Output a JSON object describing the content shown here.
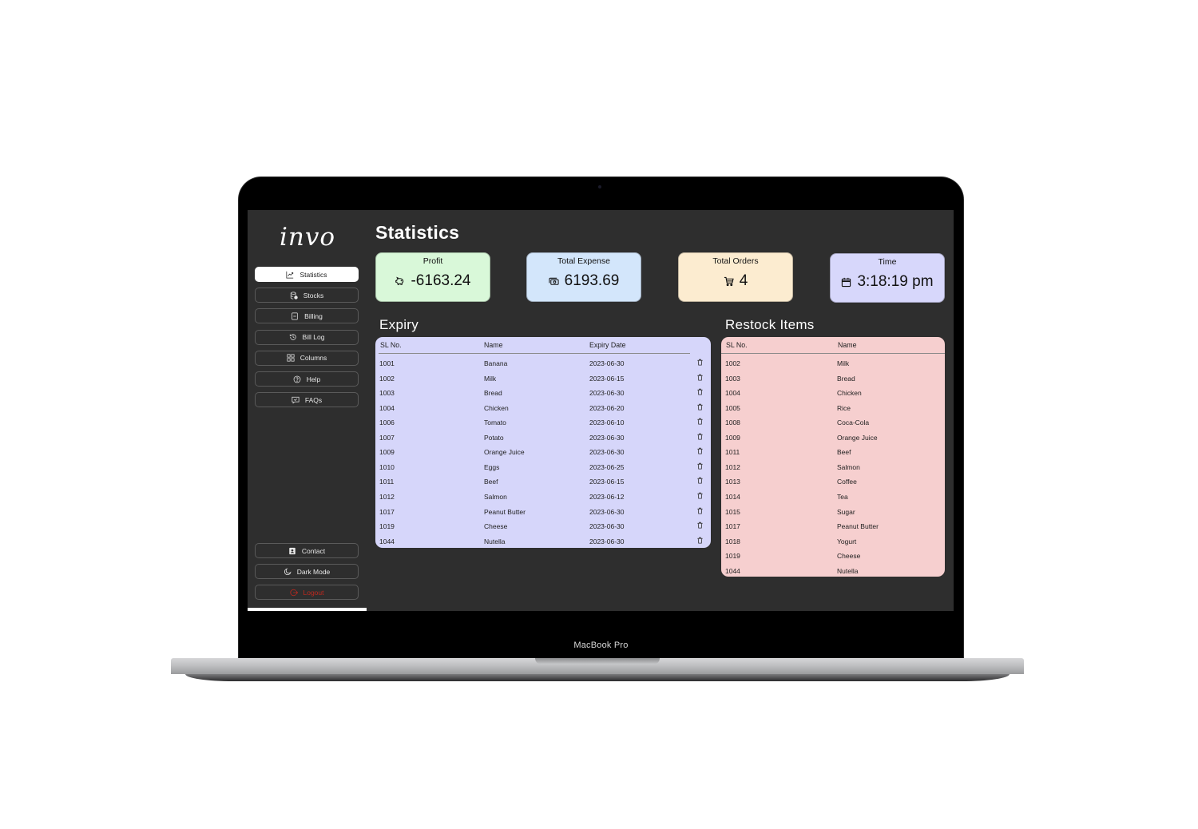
{
  "device": {
    "label": "MacBook Pro"
  },
  "app": {
    "logo": "INVO",
    "sidebar": {
      "items": [
        {
          "label": "Statistics",
          "icon": "chart-line-icon",
          "active": true
        },
        {
          "label": "Stocks",
          "icon": "database-check-icon",
          "active": false
        },
        {
          "label": "Billing",
          "icon": "receipt-icon",
          "active": false
        },
        {
          "label": "Bill Log",
          "icon": "history-icon",
          "active": false
        },
        {
          "label": "Columns",
          "icon": "grid-columns-icon",
          "active": false
        },
        {
          "label": "Help",
          "icon": "question-circle-icon",
          "active": false
        },
        {
          "label": "FAQs",
          "icon": "chat-check-icon",
          "active": false
        }
      ],
      "bottom_items": [
        {
          "label": "Contact",
          "icon": "contact-card-icon"
        },
        {
          "label": "Dark Mode",
          "icon": "moon-icon"
        },
        {
          "label": "Logout",
          "icon": "logout-icon"
        }
      ]
    },
    "page_title": "Statistics",
    "stats": [
      {
        "label": "Profit",
        "value": "-6163.24",
        "icon": "piggy-bank-icon",
        "color": "#d9f8d9"
      },
      {
        "label": "Total Expense",
        "value": "6193.69",
        "icon": "cash-icon",
        "color": "#d3e6fb"
      },
      {
        "label": "Total Orders",
        "value": "4",
        "icon": "cart-icon",
        "color": "#fcecd0"
      },
      {
        "label": "Time",
        "value": "3:18:19 pm",
        "icon": "calendar-icon",
        "color": "#d7d7fb"
      }
    ],
    "expiry": {
      "title": "Expiry",
      "columns": [
        "SL No.",
        "Name",
        "Expiry Date"
      ],
      "color": "#d6d6fa",
      "rows": [
        {
          "sl": "1001",
          "name": "Banana",
          "date": "2023-06-30"
        },
        {
          "sl": "1002",
          "name": "Milk",
          "date": "2023-06-15"
        },
        {
          "sl": "1003",
          "name": "Bread",
          "date": "2023-06-30"
        },
        {
          "sl": "1004",
          "name": "Chicken",
          "date": "2023-06-20"
        },
        {
          "sl": "1006",
          "name": "Tomato",
          "date": "2023-06-10"
        },
        {
          "sl": "1007",
          "name": "Potato",
          "date": "2023-06-30"
        },
        {
          "sl": "1009",
          "name": "Orange Juice",
          "date": "2023-06-30"
        },
        {
          "sl": "1010",
          "name": "Eggs",
          "date": "2023-06-25"
        },
        {
          "sl": "1011",
          "name": "Beef",
          "date": "2023-06-15"
        },
        {
          "sl": "1012",
          "name": "Salmon",
          "date": "2023-06-12"
        },
        {
          "sl": "1017",
          "name": "Peanut Butter",
          "date": "2023-06-30"
        },
        {
          "sl": "1019",
          "name": "Cheese",
          "date": "2023-06-30"
        },
        {
          "sl": "1044",
          "name": "Nutella",
          "date": "2023-06-30"
        }
      ]
    },
    "restock": {
      "title": "Restock Items",
      "columns": [
        "SL No.",
        "Name"
      ],
      "color": "#f6cfcf",
      "rows": [
        {
          "sl": "1002",
          "name": "Milk"
        },
        {
          "sl": "1003",
          "name": "Bread"
        },
        {
          "sl": "1004",
          "name": "Chicken"
        },
        {
          "sl": "1005",
          "name": "Rice"
        },
        {
          "sl": "1008",
          "name": "Coca-Cola"
        },
        {
          "sl": "1009",
          "name": "Orange Juice"
        },
        {
          "sl": "1011",
          "name": "Beef"
        },
        {
          "sl": "1012",
          "name": "Salmon"
        },
        {
          "sl": "1013",
          "name": "Coffee"
        },
        {
          "sl": "1014",
          "name": "Tea"
        },
        {
          "sl": "1015",
          "name": "Sugar"
        },
        {
          "sl": "1017",
          "name": "Peanut Butter"
        },
        {
          "sl": "1018",
          "name": "Yogurt"
        },
        {
          "sl": "1019",
          "name": "Cheese"
        },
        {
          "sl": "1044",
          "name": "Nutella"
        }
      ]
    }
  }
}
